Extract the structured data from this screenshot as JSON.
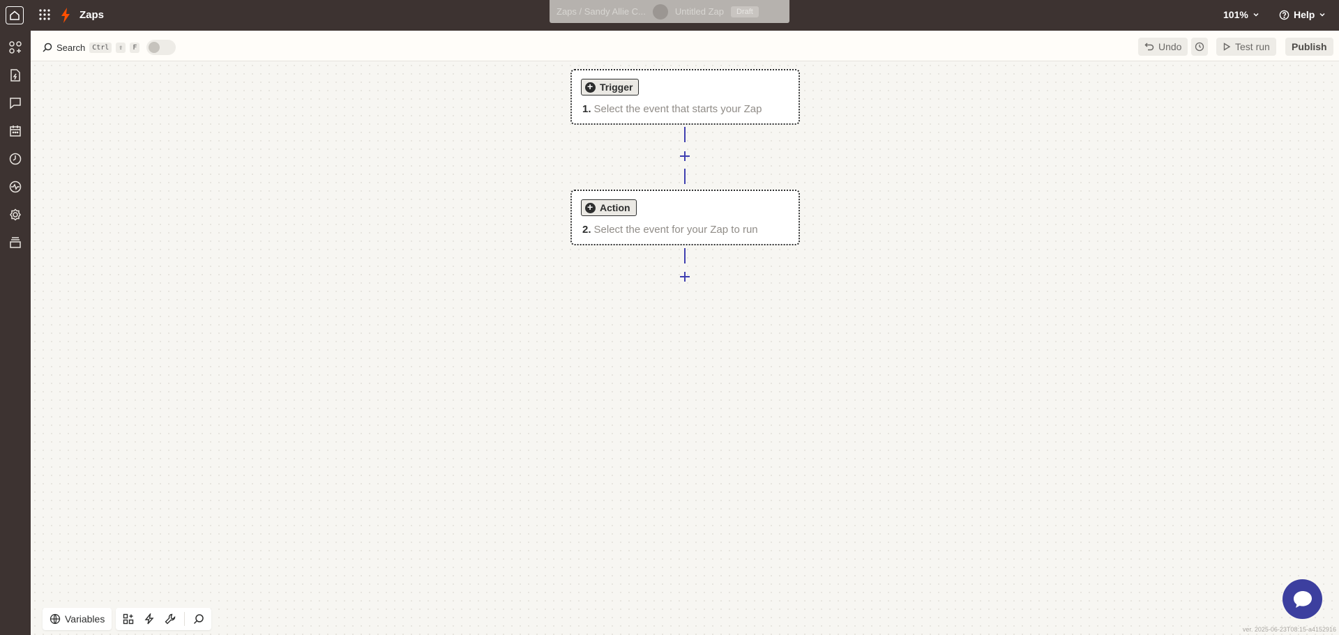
{
  "header": {
    "app_title": "Zaps",
    "zap_folder": "Zaps / Sandy Allie C...",
    "zap_name": "Untitled Zap",
    "zap_status": "Draft",
    "zoom": "101%",
    "help": "Help"
  },
  "toolbar": {
    "search_label": "Search",
    "kbd_ctrl": "Ctrl",
    "kbd_shift": "⇧",
    "kbd_f": "F",
    "undo_label": "Undo",
    "test_run_label": "Test run",
    "publish_label": "Publish"
  },
  "steps": [
    {
      "badge": "Trigger",
      "number": "1.",
      "description": "Select the event that starts your Zap"
    },
    {
      "badge": "Action",
      "number": "2.",
      "description": "Select the event for your Zap to run"
    }
  ],
  "bottom": {
    "variables_label": "Variables"
  },
  "version": "ver. 2025-06-23T08:15-a4152916",
  "colors": {
    "brand": "#ff4f00",
    "chrome": "#3d3331",
    "accent": "#3c3f9f"
  }
}
